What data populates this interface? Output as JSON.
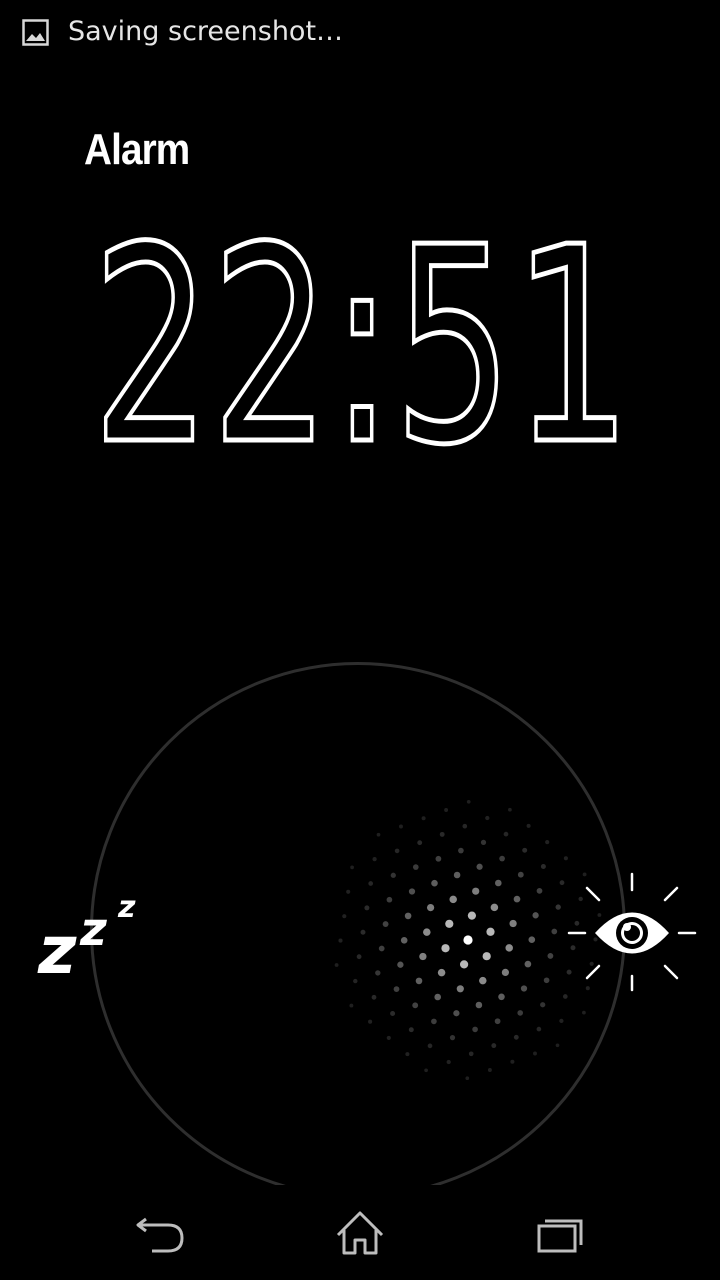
{
  "status_bar": {
    "notification_icon": "image-icon",
    "notification_text": "Saving screenshot…"
  },
  "alarm": {
    "title": "Alarm",
    "time": "22:51"
  },
  "actions": {
    "snooze_icon": "zzz-snooze-icon",
    "dismiss_icon": "eye-dismiss-icon"
  },
  "navigation": {
    "back_icon": "back-icon",
    "home_icon": "home-icon",
    "recent_apps_icon": "recent-apps-icon"
  },
  "colors": {
    "background": "#000000",
    "foreground": "#ffffff",
    "ring": "#2e2e2e"
  }
}
